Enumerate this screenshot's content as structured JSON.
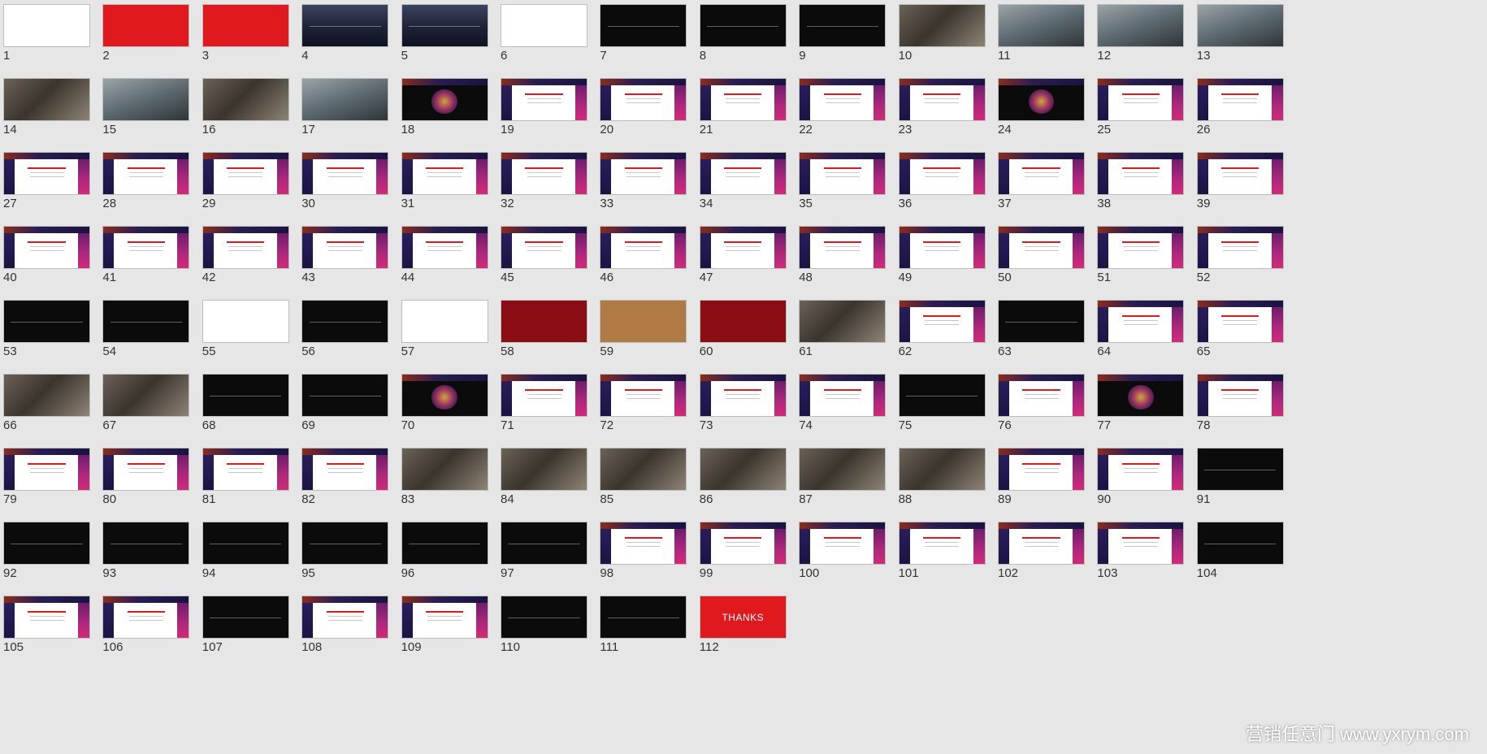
{
  "slides": [
    {
      "n": "1",
      "s": "white"
    },
    {
      "n": "2",
      "s": "red"
    },
    {
      "n": "3",
      "s": "red"
    },
    {
      "n": "4",
      "s": "night"
    },
    {
      "n": "5",
      "s": "night"
    },
    {
      "n": "6",
      "s": "white"
    },
    {
      "n": "7",
      "s": "black"
    },
    {
      "n": "8",
      "s": "black"
    },
    {
      "n": "9",
      "s": "black"
    },
    {
      "n": "10",
      "s": "photo"
    },
    {
      "n": "11",
      "s": "office"
    },
    {
      "n": "12",
      "s": "office"
    },
    {
      "n": "13",
      "s": "office"
    },
    {
      "n": "14",
      "s": "photo"
    },
    {
      "n": "15",
      "s": "office"
    },
    {
      "n": "16",
      "s": "photo"
    },
    {
      "n": "17",
      "s": "office"
    },
    {
      "n": "18",
      "s": "flower"
    },
    {
      "n": "19",
      "s": "template"
    },
    {
      "n": "20",
      "s": "template"
    },
    {
      "n": "21",
      "s": "template"
    },
    {
      "n": "22",
      "s": "template"
    },
    {
      "n": "23",
      "s": "template"
    },
    {
      "n": "24",
      "s": "flower"
    },
    {
      "n": "25",
      "s": "template"
    },
    {
      "n": "26",
      "s": "template"
    },
    {
      "n": "27",
      "s": "template"
    },
    {
      "n": "28",
      "s": "template"
    },
    {
      "n": "29",
      "s": "template"
    },
    {
      "n": "30",
      "s": "template"
    },
    {
      "n": "31",
      "s": "template"
    },
    {
      "n": "32",
      "s": "template"
    },
    {
      "n": "33",
      "s": "template"
    },
    {
      "n": "34",
      "s": "template"
    },
    {
      "n": "35",
      "s": "template"
    },
    {
      "n": "36",
      "s": "template"
    },
    {
      "n": "37",
      "s": "template"
    },
    {
      "n": "38",
      "s": "template"
    },
    {
      "n": "39",
      "s": "template"
    },
    {
      "n": "40",
      "s": "template"
    },
    {
      "n": "41",
      "s": "template"
    },
    {
      "n": "42",
      "s": "template"
    },
    {
      "n": "43",
      "s": "template"
    },
    {
      "n": "44",
      "s": "template"
    },
    {
      "n": "45",
      "s": "template"
    },
    {
      "n": "46",
      "s": "template"
    },
    {
      "n": "47",
      "s": "template"
    },
    {
      "n": "48",
      "s": "template"
    },
    {
      "n": "49",
      "s": "template"
    },
    {
      "n": "50",
      "s": "template"
    },
    {
      "n": "51",
      "s": "template"
    },
    {
      "n": "52",
      "s": "template"
    },
    {
      "n": "53",
      "s": "black"
    },
    {
      "n": "54",
      "s": "black"
    },
    {
      "n": "55",
      "s": "white"
    },
    {
      "n": "56",
      "s": "black"
    },
    {
      "n": "57",
      "s": "white"
    },
    {
      "n": "58",
      "s": "darkred"
    },
    {
      "n": "59",
      "s": "brown"
    },
    {
      "n": "60",
      "s": "darkred"
    },
    {
      "n": "61",
      "s": "photo"
    },
    {
      "n": "62",
      "s": "template"
    },
    {
      "n": "63",
      "s": "black"
    },
    {
      "n": "64",
      "s": "template"
    },
    {
      "n": "65",
      "s": "template"
    },
    {
      "n": "66",
      "s": "photo"
    },
    {
      "n": "67",
      "s": "photo"
    },
    {
      "n": "68",
      "s": "black"
    },
    {
      "n": "69",
      "s": "black"
    },
    {
      "n": "70",
      "s": "flower"
    },
    {
      "n": "71",
      "s": "template"
    },
    {
      "n": "72",
      "s": "template"
    },
    {
      "n": "73",
      "s": "template"
    },
    {
      "n": "74",
      "s": "template"
    },
    {
      "n": "75",
      "s": "black"
    },
    {
      "n": "76",
      "s": "template"
    },
    {
      "n": "77",
      "s": "flower"
    },
    {
      "n": "78",
      "s": "template"
    },
    {
      "n": "79",
      "s": "template"
    },
    {
      "n": "80",
      "s": "template"
    },
    {
      "n": "81",
      "s": "template"
    },
    {
      "n": "82",
      "s": "template"
    },
    {
      "n": "83",
      "s": "photo"
    },
    {
      "n": "84",
      "s": "photo"
    },
    {
      "n": "85",
      "s": "photo"
    },
    {
      "n": "86",
      "s": "photo"
    },
    {
      "n": "87",
      "s": "photo"
    },
    {
      "n": "88",
      "s": "photo"
    },
    {
      "n": "89",
      "s": "template"
    },
    {
      "n": "90",
      "s": "template"
    },
    {
      "n": "91",
      "s": "black"
    },
    {
      "n": "92",
      "s": "black"
    },
    {
      "n": "93",
      "s": "black"
    },
    {
      "n": "94",
      "s": "black"
    },
    {
      "n": "95",
      "s": "black"
    },
    {
      "n": "96",
      "s": "black"
    },
    {
      "n": "97",
      "s": "black"
    },
    {
      "n": "98",
      "s": "template"
    },
    {
      "n": "99",
      "s": "template"
    },
    {
      "n": "100",
      "s": "template"
    },
    {
      "n": "101",
      "s": "template"
    },
    {
      "n": "102",
      "s": "template"
    },
    {
      "n": "103",
      "s": "template"
    },
    {
      "n": "104",
      "s": "black"
    },
    {
      "n": "105",
      "s": "template"
    },
    {
      "n": "106",
      "s": "template"
    },
    {
      "n": "107",
      "s": "black"
    },
    {
      "n": "108",
      "s": "template"
    },
    {
      "n": "109",
      "s": "template"
    },
    {
      "n": "110",
      "s": "black"
    },
    {
      "n": "111",
      "s": "black"
    },
    {
      "n": "112",
      "s": "thanks",
      "label": "THANKS"
    }
  ],
  "watermark": "营销任意门 www.yxrym.com",
  "colors": {
    "background": "#e6e6e6",
    "brand_red": "#e0191f",
    "template_top": "#2a1d52",
    "template_right": "#b0287d"
  }
}
